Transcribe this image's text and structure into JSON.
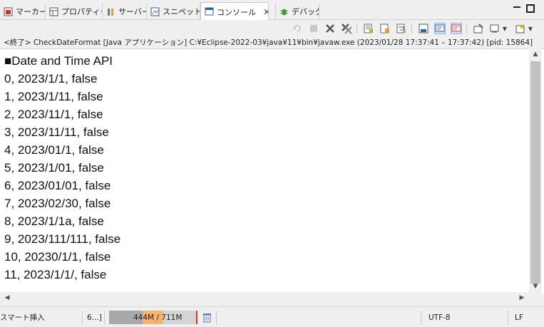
{
  "tabs": [
    {
      "label": "マーカー",
      "icon": "markers-icon"
    },
    {
      "label": "プロパティー",
      "icon": "properties-icon"
    },
    {
      "label": "サーバー",
      "icon": "servers-icon"
    },
    {
      "label": "スニペット",
      "icon": "snippets-icon"
    },
    {
      "label": "コンソール",
      "icon": "console-icon",
      "active": true
    },
    {
      "label": "デバッグ",
      "icon": "debug-icon"
    }
  ],
  "process_info": "<終了> CheckDateFormat [Java アプリケーション] C:¥Eclipse-2022-03¥java¥11¥bin¥javaw.exe  (2023/01/28 17:37:41 – 17:37:42) [pid: 15864]",
  "console_lines": [
    "■Date and Time API",
    "0, 2023/1/1, false",
    "1, 2023/1/11, false",
    "2, 2023/11/1, false",
    "3, 2023/11/11, false",
    "4, 2023/01/1, false",
    "5, 2023/1/01, false",
    "6, 2023/01/01, false",
    "7, 2023/02/30, false",
    "8, 2023/1/1a, false",
    "9, 2023/111/111, false",
    "10, 20230/1/1, false",
    "11, 2023/1/1/, false"
  ],
  "status": {
    "insert_mode": "スマート挿入",
    "position": "6...]",
    "heap": "444M / 711M",
    "heap_used_fraction": 0.62,
    "encoding": "UTF-8",
    "line_delimiter": "LF"
  },
  "colors": {
    "heap_used": "#a9a9a9",
    "heap_recent": "#f5b270",
    "heap_limit": "#dd3333"
  }
}
